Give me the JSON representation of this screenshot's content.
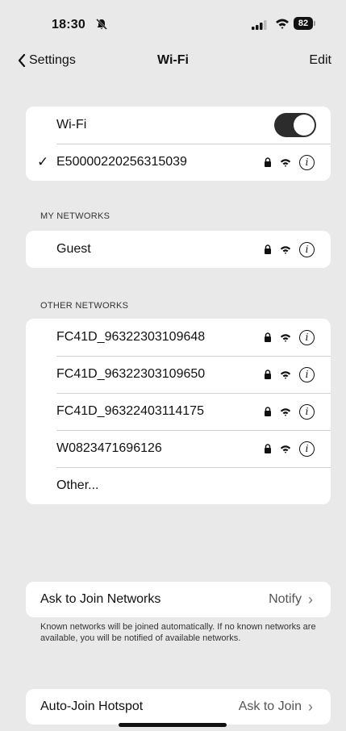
{
  "status_bar": {
    "time": "18:30",
    "battery": "82"
  },
  "nav": {
    "back_label": "Settings",
    "title": "Wi-Fi",
    "edit_label": "Edit"
  },
  "wifi": {
    "label": "Wi-Fi",
    "enabled": true,
    "connected_network": "E50000220256315039"
  },
  "my_networks": {
    "header": "MY NETWORKS",
    "items": [
      {
        "name": "Guest"
      }
    ]
  },
  "other_networks": {
    "header": "OTHER NETWORKS",
    "items": [
      {
        "name": "FC41D_96322303109648"
      },
      {
        "name": "FC41D_96322303109650"
      },
      {
        "name": "FC41D_96322403114175"
      },
      {
        "name": "W0823471696126"
      }
    ],
    "other_label": "Other..."
  },
  "ask_to_join": {
    "label": "Ask to Join Networks",
    "value": "Notify",
    "footnote": "Known networks will be joined automatically. If no known networks are available, you will be notified of available networks."
  },
  "auto_join_hotspot": {
    "label": "Auto-Join Hotspot",
    "value": "Ask to Join"
  }
}
